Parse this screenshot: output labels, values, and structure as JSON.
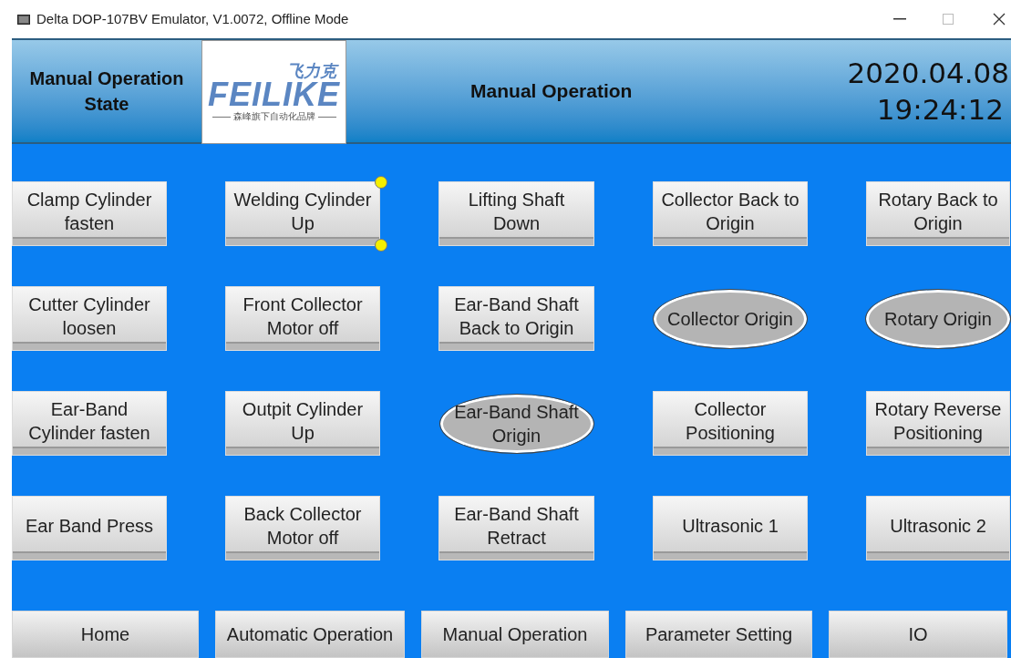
{
  "window": {
    "title": "Delta DOP-107BV Emulator, V1.0072, Offline Mode"
  },
  "header": {
    "state_label": "Manual Operation State",
    "logo": {
      "chinese": "飞力克",
      "brand": "FEILIKE",
      "tagline": "森峰旗下自动化品牌"
    },
    "screen_title": "Manual Operation",
    "date": "2020.04.08",
    "time": "19:24:12"
  },
  "buttons": [
    {
      "kind": "button",
      "label": "Clamp Cylinder\nfasten",
      "selected": false
    },
    {
      "kind": "button",
      "label": "Welding Cylinder\nUp",
      "selected": true
    },
    {
      "kind": "button",
      "label": "Lifting Shaft\nDown",
      "selected": false
    },
    {
      "kind": "button",
      "label": "Collector Back to\nOrigin",
      "selected": false
    },
    {
      "kind": "button",
      "label": "Rotary Back to\nOrigin",
      "selected": false
    },
    {
      "kind": "button",
      "label": "Cutter Cylinder\nloosen",
      "selected": false
    },
    {
      "kind": "button",
      "label": "Front Collector\nMotor off",
      "selected": false
    },
    {
      "kind": "button",
      "label": "Ear-Band Shaft\nBack to Origin",
      "selected": false
    },
    {
      "kind": "indicator",
      "label": "Collector Origin",
      "selected": false
    },
    {
      "kind": "indicator",
      "label": "Rotary Origin",
      "selected": false
    },
    {
      "kind": "button",
      "label": "Ear-Band\nCylinder fasten",
      "selected": false
    },
    {
      "kind": "button",
      "label": "Outpit Cylinder\nUp",
      "selected": false
    },
    {
      "kind": "indicator",
      "label": "Ear-Band Shaft\nOrigin",
      "selected": false
    },
    {
      "kind": "button",
      "label": "Collector\nPositioning",
      "selected": false
    },
    {
      "kind": "button",
      "label": "Rotary Reverse\nPositioning",
      "selected": false
    },
    {
      "kind": "button",
      "label": "Ear Band Press",
      "selected": false
    },
    {
      "kind": "button",
      "label": "Back Collector\nMotor off",
      "selected": false
    },
    {
      "kind": "button",
      "label": "Ear-Band Shaft\nRetract",
      "selected": false
    },
    {
      "kind": "button",
      "label": "Ultrasonic 1",
      "selected": false
    },
    {
      "kind": "button",
      "label": "Ultrasonic 2",
      "selected": false
    }
  ],
  "nav": [
    "Home",
    "Automatic Operation",
    "Manual Operation",
    "Parameter Setting",
    "IO"
  ]
}
